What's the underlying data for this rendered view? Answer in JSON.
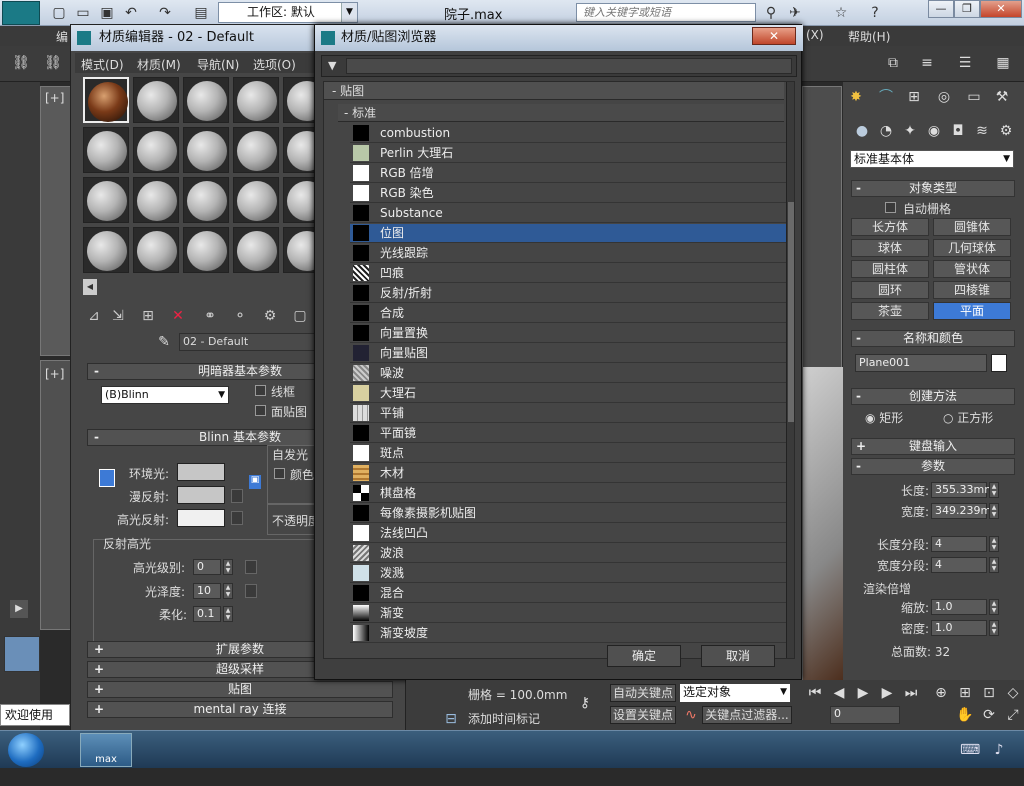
{
  "top": {
    "workspace_label": "工作区: 默认",
    "filename": "院子.max",
    "search_placeholder": "键入关键字或短语"
  },
  "mainmenu": {
    "items": [
      "编",
      "(X)",
      "帮助(H)"
    ]
  },
  "viewports": {
    "label_1": "[+]",
    "label_2": "[+]"
  },
  "cmdpanel": {
    "dropdown": "标准基本体",
    "object_type": "对象类型",
    "autogrid": "自动栅格",
    "buttons": [
      "长方体",
      "圆锥体",
      "球体",
      "几何球体",
      "圆柱体",
      "管状体",
      "圆环",
      "四棱锥",
      "茶壶",
      "平面"
    ],
    "name_color": "名称和颜色",
    "object_name": "Plane001",
    "creation_method": "创建方法",
    "radio_1": "矩形",
    "radio_2": "正方形",
    "keyboard_entry": "键盘输入",
    "params": "参数",
    "length_label": "长度:",
    "length_value": "355.33mm",
    "width_label": "宽度:",
    "width_value": "349.239m",
    "lseg_label": "长度分段:",
    "lseg_value": "4",
    "wseg_label": "宽度分段:",
    "wseg_value": "4",
    "render_mult": "渲染倍增",
    "scale_label": "缩放:",
    "scale_value": "1.0",
    "density_label": "密度:",
    "density_value": "1.0",
    "total_faces": "总面数: 32",
    "select_object": "选定对象"
  },
  "matedit": {
    "title": "材质编辑器 - 02 - Default",
    "menu": [
      "模式(D)",
      "材质(M)",
      "导航(N)",
      "选项(O)"
    ],
    "material_name": "02 - Default",
    "shader_rollout": "明暗器基本参数",
    "shader_type": "(B)Blinn",
    "wire": "线框",
    "faceted": "面贴图",
    "blinn_rollout": "Blinn 基本参数",
    "ambient": "环境光:",
    "diffuse": "漫反射:",
    "specular": "高光反射:",
    "self_illum": "自发光",
    "color": "颜色",
    "opacity": "不透明度",
    "spec_highlights": "反射高光",
    "spec_level": "高光级别:",
    "spec_level_value": "0",
    "glossiness": "光泽度:",
    "glossiness_value": "10",
    "soften": "柔化:",
    "soften_value": "0.1",
    "extended": "扩展参数",
    "supersampling": "超级采样",
    "maps": "贴图",
    "mental_ray": "mental ray 连接",
    "welcome": "欢迎使用"
  },
  "browser": {
    "title": "材质/贴图浏览器",
    "group_maps": "贴图",
    "group_standard": "标准",
    "items": [
      "combustion",
      "Perlin 大理石",
      "RGB 倍增",
      "RGB 染色",
      "Substance",
      "位图",
      "光线跟踪",
      "凹痕",
      "反射/折射",
      "合成",
      "向量置换",
      "向量贴图",
      "噪波",
      "大理石",
      "平铺",
      "平面镜",
      "斑点",
      "木材",
      "棋盘格",
      "每像素摄影机贴图",
      "法线凹凸",
      "波浪",
      "泼溅",
      "混合",
      "渐变",
      "渐变坡度"
    ],
    "selected_index": 5,
    "ok": "确定",
    "cancel": "取消"
  },
  "bottom": {
    "grid": "栅格 = 100.0mm",
    "add_time_tag": "添加时间标记",
    "auto_key": "自动关键点",
    "set_key": "设置关键点",
    "key_filter": "关键点过滤器...",
    "frame_value": "0"
  },
  "taskbar": {
    "app": "max"
  },
  "colors": {
    "selected": "#2f5a96",
    "accent": "#3d7ad6"
  }
}
